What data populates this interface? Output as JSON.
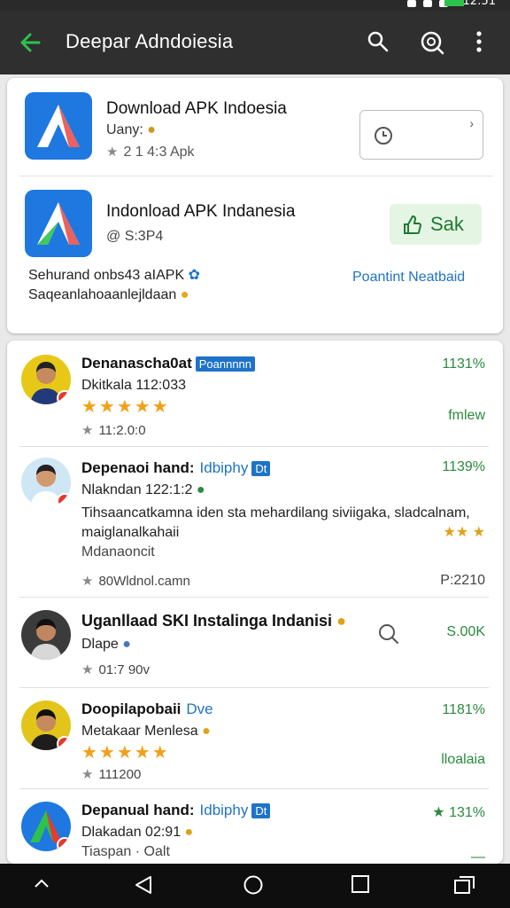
{
  "status": {
    "time": "12:51"
  },
  "appbar": {
    "title": "Deepar Adndoiesia"
  },
  "apps": [
    {
      "title": "Download APK Indoesia",
      "sub": "Uany:",
      "rating": "2 1 4:3 Apk"
    },
    {
      "title": "Indonload APK Indanesia",
      "sub": "@ S:3P4"
    }
  ],
  "app_actions": {
    "install_label": "Sak",
    "link_text": "Poantint Neatbaid"
  },
  "app_desc": {
    "line1": "Sehurand onbs43 aIAPK",
    "line2": "Saqeanlahoaanlejldaan"
  },
  "reviews": [
    {
      "name": "Denanascha0at",
      "tag": "Poannnnn",
      "line1": "Dkitkala 112:033",
      "meta": "11:2.0:0",
      "right_top": "1131%",
      "right_bottom": "fmlew"
    },
    {
      "name": "Depenaoi hand:",
      "tag_text": "Idbiphy",
      "tag": "Dt",
      "line1": "Nlakndan 122:1:2",
      "body1": "Tihsaancatkamna iden sta mehardilang siviigaka, sladcalnam,",
      "body2": "maiglanalkahaii",
      "body3": "Mdanaoncit",
      "meta": "80Wldnol.camn",
      "right_top": "1139%",
      "right_stars": "★★ ★",
      "right_bottom": "P:2210"
    },
    {
      "name": "Uganllaad SKI Instalinga Indanisi",
      "line1": "Dlape",
      "meta": "01:7 90v",
      "right_top": "S.00K"
    },
    {
      "name": "Doopilapobaii",
      "tag_text": "Dve",
      "line1": "Metakaar Menlesa",
      "meta": "111200",
      "right_top": "1181%",
      "right_bottom": "lloalaia"
    },
    {
      "name": "Depanual hand:",
      "tag_text": "Idbiphy",
      "tag": "Dt",
      "line1": "Dlakadan 02:91",
      "body1": "Tiaspan · Oalt",
      "right_top": "★ 131%",
      "right_bottom": "—"
    }
  ],
  "colors": {
    "accent": "#2ec24a",
    "link": "#1e73c8",
    "green_text": "#2b8a3e",
    "star": "#f1a018"
  }
}
